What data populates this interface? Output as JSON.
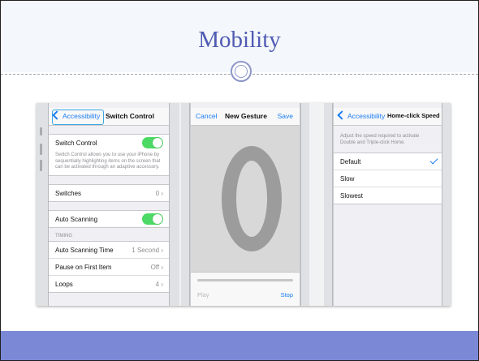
{
  "slide": {
    "title": "Mobility",
    "colors": {
      "title": "#4f5bb3",
      "footer": "#7b88d6",
      "ios_blue": "#1a7cf5",
      "switch_on": "#4cd964"
    }
  },
  "screen1": {
    "back_label": "Accessibility",
    "title": "Switch Control",
    "switch_control": {
      "label": "Switch Control",
      "on": true
    },
    "description": "Switch Control allows you to use your iPhone by sequentially highlighting items on the screen that can be activated through an adaptive accessory.",
    "switches": {
      "label": "Switches",
      "value": "0"
    },
    "auto_scanning": {
      "label": "Auto Scanning",
      "on": true
    },
    "timing_header": "TIMING",
    "rows": [
      {
        "label": "Auto Scanning Time",
        "value": "1 Second"
      },
      {
        "label": "Pause on First Item",
        "value": "Off"
      },
      {
        "label": "Loops",
        "value": "4"
      }
    ]
  },
  "screen2": {
    "cancel_label": "Cancel",
    "title": "New Gesture",
    "save_label": "Save",
    "play_label": "Play",
    "stop_label": "Stop"
  },
  "screen3": {
    "back_label": "Accessibility",
    "title": "Home-click Speed",
    "description": "Adjust the speed required to activate Double and Triple-click Home.",
    "options": [
      "Default",
      "Slow",
      "Slowest"
    ],
    "selected": "Default"
  }
}
